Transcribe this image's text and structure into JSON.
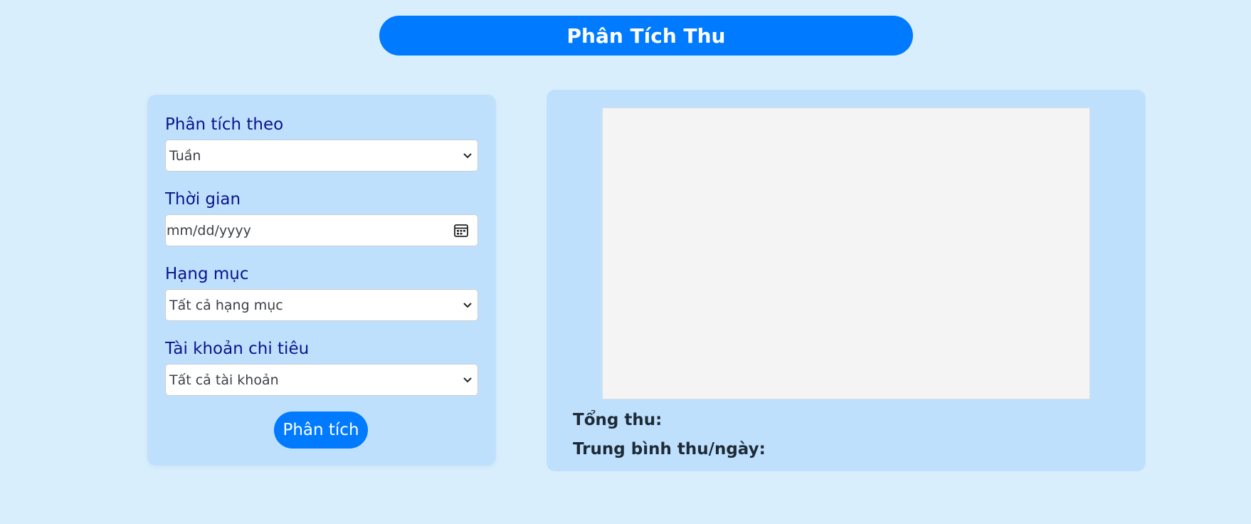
{
  "header": {
    "title": "Phân Tích Thu"
  },
  "form": {
    "fields": [
      {
        "label": "Phân tích theo",
        "value": "Tuần",
        "type": "select"
      },
      {
        "label": "Thời gian",
        "placeholder": "mm/dd/yyyy",
        "type": "date"
      },
      {
        "label": "Hạng mục",
        "value": "Tất cả hạng mục",
        "type": "select"
      },
      {
        "label": "Tài khoản chi tiêu",
        "value": "Tất cả tài khoản",
        "type": "select"
      }
    ],
    "submit_label": "Phân tích"
  },
  "results": {
    "total_label": "Tổng thu:",
    "average_label": "Trung bình thu/ngày:"
  },
  "icons": {
    "select_chevron": "chevron-down-icon",
    "date_picker": "calendar-icon"
  },
  "colors": {
    "page_background": "#d9eefd",
    "panel_background": "#bfe0fd",
    "accent": "#007bff",
    "label_text": "#0a148c",
    "chart_placeholder": "#f4f4f4"
  }
}
